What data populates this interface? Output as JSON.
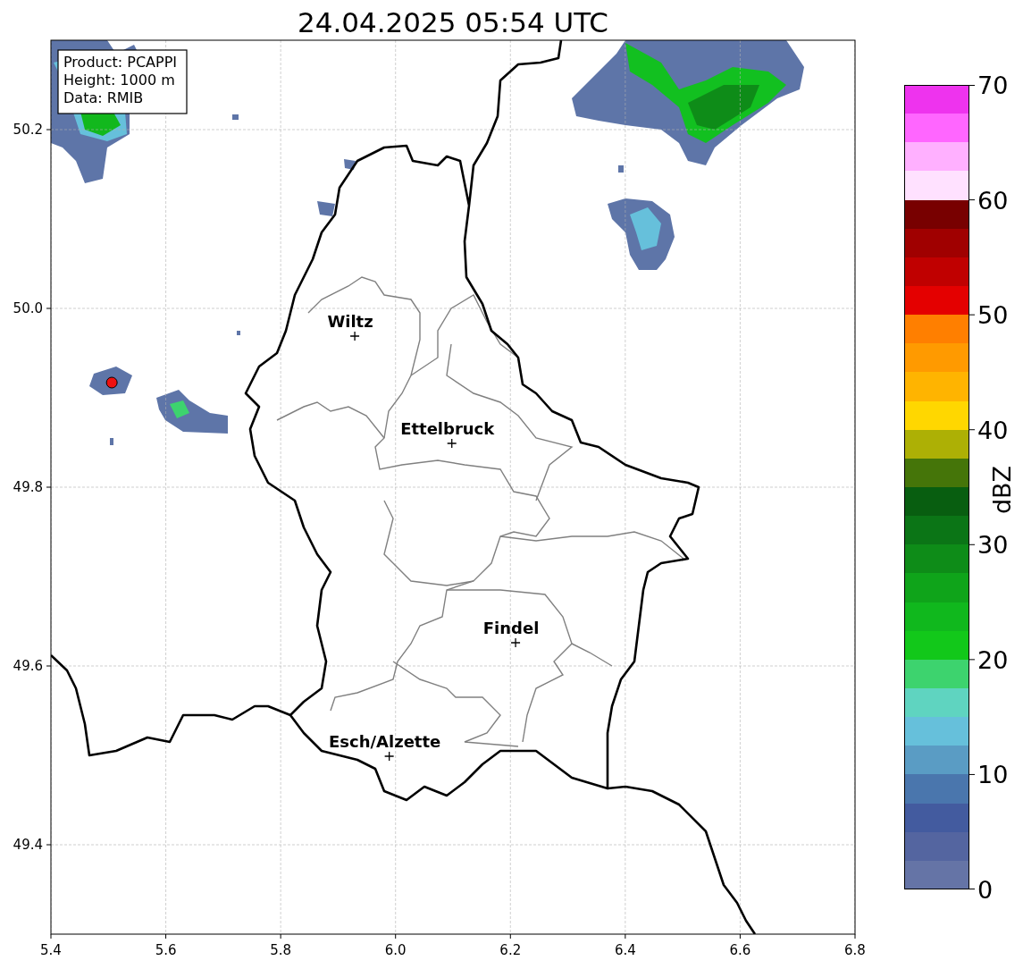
{
  "title": "24.04.2025 05:54 UTC",
  "info_box": [
    "Product: PCAPPI",
    "Height: 1000 m",
    "Data: RMIB"
  ],
  "map": {
    "y_ticks": [
      "50.2",
      "50.0",
      "49.8",
      "49.6",
      "49.4"
    ],
    "x_ticks": [
      "5.4",
      "5.6",
      "5.8",
      "6.0",
      "6.2",
      "6.4",
      "6.6",
      "6.8"
    ],
    "city_labels": [
      "Wiltz",
      "Ettelbruck",
      "Findel",
      "Esch/Alzette"
    ]
  },
  "colorbar": {
    "label": "dBZ",
    "ticks": [
      "70",
      "60",
      "50",
      "40",
      "30",
      "20",
      "10",
      "0"
    ]
  }
}
